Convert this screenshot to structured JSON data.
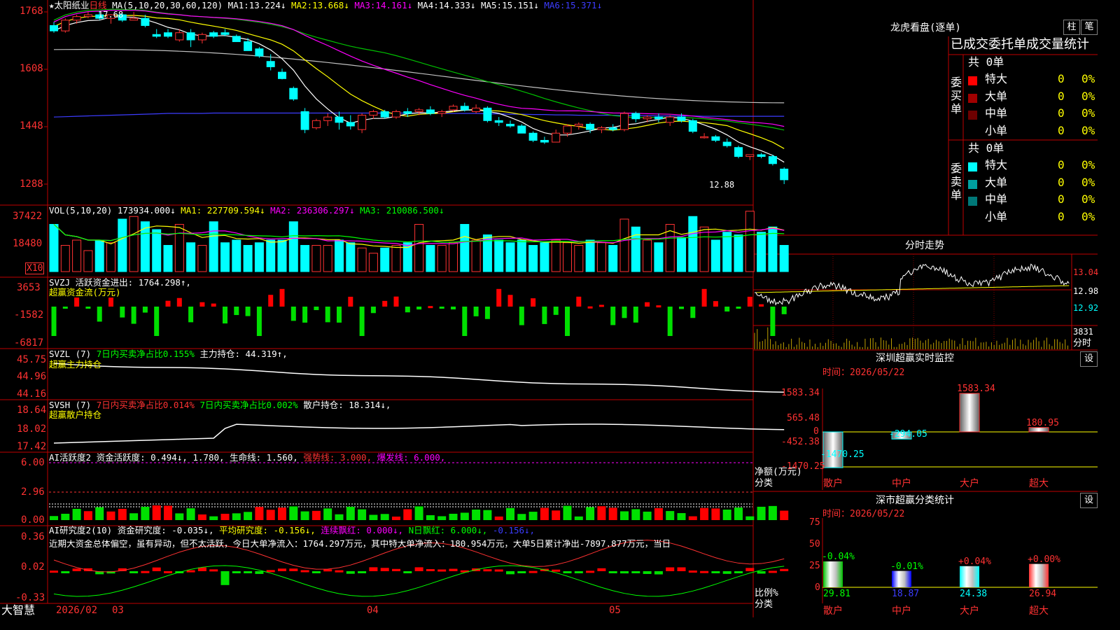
{
  "stock": {
    "star": "★",
    "name": "太阳纸业",
    "period": "日线",
    "ma_label": "MA(5,10,20,30,60,120)"
  },
  "price_panel": {
    "ma_values": [
      {
        "name": "MA1:",
        "value": "13.224↓",
        "color": "#ffffff"
      },
      {
        "name": "MA2:",
        "value": "13.668↓",
        "color": "#ffff00"
      },
      {
        "name": "MA3:",
        "value": "14.161↓",
        "color": "#ff00ff"
      },
      {
        "name": "MA4:",
        "value": "14.333↓",
        "color": "#00ff00"
      },
      {
        "name": "MA5:",
        "value": "15.151↓",
        "color": "#c0c0c0"
      },
      {
        "name": "MA6:",
        "value": "15.371↓",
        "color": "#3c3cff"
      }
    ],
    "y_ticks": [
      "1768",
      "1608",
      "1448",
      "1288"
    ],
    "high_label": "17.68",
    "low_label": "12.88",
    "colors": {
      "up": "#ff3232",
      "down": "#00ffff",
      "ma1": "#ffffff",
      "ma2": "#ffff00",
      "ma3": "#ff00ff",
      "ma4": "#00ff00",
      "ma5": "#c0c0c0",
      "ma6": "#3c3cff"
    }
  },
  "vol_panel": {
    "label": "VOL(5,10,20)",
    "value": "173934.000↓",
    "ma1": "MA1: 227709.594↓",
    "ma2": "MA2: 236306.297↓",
    "ma3": "MA3: 210086.500↓",
    "y_ticks": [
      "37422",
      "18480"
    ],
    "unit": "X10"
  },
  "svzj_panel": {
    "label": "SVZJ",
    "title": "活跃资金进出: 1764.298↑,",
    "subtitle": "超赢资金流(万元)",
    "y_ticks": [
      "3653",
      "-1582",
      "-6817"
    ]
  },
  "svzl_panel": {
    "label": "SVZL (7)",
    "t1": "7日内买卖净占比0.155%",
    "t2": "主力持仓: 44.319↑,",
    "subtitle": "超赢主力持仓",
    "y_ticks": [
      "45.75",
      "44.96",
      "44.16"
    ]
  },
  "svsh_panel": {
    "label": "SVSH (7)",
    "t1": "7日内买卖净占比0.014%",
    "t2": "7日内买卖净占比0.002%",
    "t3": "散户持仓: 18.314↓,",
    "subtitle": "超赢散户持仓",
    "y_ticks": [
      "18.64",
      "18.02",
      "17.42"
    ]
  },
  "ai1_panel": {
    "label": "AI活跃度2",
    "t1": "资金活跃度: 0.494↓,",
    "t2": "1.780,",
    "t3": "生命线: 1.560,",
    "t4": "强势线: 3.000,",
    "t5": "爆发线: 6.000,",
    "y_ticks": [
      "6.00",
      "2.96",
      "0.00"
    ]
  },
  "ai2_panel": {
    "label": "AI研究度2(10)",
    "t1": "资金研究度: -0.035↓,",
    "t2": "平均研究度: -0.156↓,",
    "t3": "连续飘红: 0.000↓,",
    "t4": "N日飘红: 6.000↓,",
    "t5": "-0.156↓,",
    "comment": "近期大资金总体偏空，虽有异动，但不太活跃，今日大单净流入：1764.297万元，其中特大单净流入：180.954万元，大单5日累计净出-7897.877万元，当日",
    "y_ticks": [
      "0.36",
      "0.02",
      "-0.33"
    ]
  },
  "xaxis": {
    "brand": "大智慧",
    "labels": [
      "2026/02",
      "03",
      "04",
      "05"
    ]
  },
  "dragon": {
    "title": "龙虎看盘(逐单)",
    "btn1": "柱",
    "btn2": "笔",
    "header": "已成交委托单成交量统计",
    "buy": {
      "side": "委买单",
      "total": "共 0单",
      "rows": [
        {
          "name": "特大",
          "v": "0",
          "p": "0%",
          "c": "#ff0000"
        },
        {
          "name": "大单",
          "v": "0",
          "p": "0%",
          "c": "#a00000"
        },
        {
          "name": "中单",
          "v": "0",
          "p": "0%",
          "c": "#6e0000"
        },
        {
          "name": "小单",
          "v": "0",
          "p": "0%",
          "c": "#000000"
        }
      ]
    },
    "sell": {
      "side": "委卖单",
      "total": "共 0单",
      "rows": [
        {
          "name": "特大",
          "v": "0",
          "p": "0%",
          "c": "#00ffff"
        },
        {
          "name": "大单",
          "v": "0",
          "p": "0%",
          "c": "#00a0a0"
        },
        {
          "name": "中单",
          "v": "0",
          "p": "0%",
          "c": "#007878"
        },
        {
          "name": "小单",
          "v": "0",
          "p": "0%",
          "c": "#000000"
        }
      ]
    }
  },
  "intraday": {
    "title": "分时走势",
    "price_labels": [
      "13.04",
      "12.98",
      "12.92"
    ],
    "vol_label": "3831",
    "footer": "分时"
  },
  "monitor": {
    "title": "深圳超赢实时监控",
    "btn": "设",
    "date": "时间：2026/05/22",
    "y_ticks": [
      "1583.34",
      "565.48",
      "0",
      "-452.38",
      "-1470.25"
    ],
    "ylabel1": "净额(万元)",
    "ylabel2": "分类",
    "bars": [
      {
        "cat": "散户",
        "value": -1470.25,
        "label": "-1470.25"
      },
      {
        "cat": "中户",
        "value": -294.05,
        "label": "-294.05"
      },
      {
        "cat": "大户",
        "value": 1583.34,
        "label": "1583.34"
      },
      {
        "cat": "超大",
        "value": 180.95,
        "label": "180.95"
      }
    ]
  },
  "classify": {
    "title": "深市超赢分类统计",
    "btn": "设",
    "date": "时间：2026/05/22",
    "y_ticks": [
      "75",
      "50",
      "25",
      "0"
    ],
    "ylabel1": "比例%",
    "ylabel2": "分类",
    "bars": [
      {
        "cat": "散户",
        "value": 29.81,
        "label": "29.81",
        "chg": "-0.04%",
        "col": "#00c000"
      },
      {
        "cat": "中户",
        "value": 18.87,
        "label": "18.87",
        "chg": "-0.01%",
        "col": "#0000ff"
      },
      {
        "cat": "大户",
        "value": 24.38,
        "label": "24.38",
        "chg": "+0.04%",
        "col": "#00ffff"
      },
      {
        "cat": "超大",
        "value": 26.94,
        "label": "26.94",
        "chg": "+0.00%",
        "col": "#ff3232"
      }
    ]
  },
  "chart_data": [
    {
      "type": "candlestick",
      "title": "太阳纸业 日线",
      "ylim": [
        12.7,
        17.8
      ],
      "x": [
        "2026/02",
        "03",
        "04",
        "05"
      ],
      "ohlc": [
        [
          17.3,
          17.4,
          17.1,
          17.15
        ],
        [
          17.15,
          17.5,
          17.1,
          17.45
        ],
        [
          17.45,
          17.6,
          17.35,
          17.55
        ],
        [
          17.55,
          17.68,
          17.5,
          17.6
        ],
        [
          17.6,
          17.7,
          17.45,
          17.5
        ],
        [
          17.5,
          17.62,
          17.35,
          17.6
        ],
        [
          17.6,
          17.65,
          17.4,
          17.45
        ],
        [
          17.45,
          17.68,
          17.45,
          17.5
        ],
        [
          17.5,
          17.6,
          17.25,
          17.3
        ],
        [
          17.05,
          17.2,
          16.95,
          17.0
        ],
        [
          17.1,
          17.2,
          16.95,
          17.0
        ],
        [
          16.9,
          17.2,
          16.85,
          17.1
        ],
        [
          17.1,
          17.2,
          16.7,
          16.9
        ],
        [
          16.9,
          17.1,
          16.8,
          17.05
        ],
        [
          17.1,
          17.15,
          16.95,
          17.0
        ],
        [
          17.1,
          17.2,
          17.0,
          17.05
        ],
        [
          17.0,
          17.05,
          16.85,
          16.85
        ],
        [
          16.85,
          16.95,
          16.6,
          16.6
        ],
        [
          16.65,
          16.7,
          16.4,
          16.45
        ],
        [
          16.3,
          16.5,
          16.05,
          16.15
        ],
        [
          16.0,
          16.1,
          15.8,
          15.82
        ],
        [
          15.55,
          15.6,
          15.2,
          15.25
        ],
        [
          14.9,
          15.0,
          14.3,
          14.4
        ],
        [
          14.45,
          14.7,
          14.4,
          14.65
        ],
        [
          14.65,
          14.85,
          14.5,
          14.75
        ],
        [
          14.75,
          14.9,
          14.4,
          14.6
        ],
        [
          14.6,
          14.8,
          14.4,
          14.5
        ],
        [
          14.4,
          14.85,
          14.3,
          14.8
        ],
        [
          14.8,
          14.95,
          14.7,
          14.9
        ],
        [
          14.9,
          14.95,
          14.7,
          14.75
        ],
        [
          14.75,
          14.95,
          14.7,
          14.9
        ],
        [
          14.9,
          15.0,
          14.75,
          14.85
        ],
        [
          14.9,
          15.0,
          14.8,
          14.95
        ],
        [
          14.95,
          15.05,
          14.8,
          14.85
        ],
        [
          14.85,
          14.95,
          14.75,
          14.9
        ],
        [
          14.95,
          15.1,
          14.9,
          15.05
        ],
        [
          15.05,
          15.15,
          14.9,
          14.95
        ],
        [
          14.9,
          15.1,
          14.85,
          15.0
        ],
        [
          15.0,
          15.05,
          14.6,
          14.65
        ],
        [
          14.65,
          14.75,
          14.5,
          14.6
        ],
        [
          14.55,
          14.65,
          14.45,
          14.5
        ],
        [
          14.5,
          14.55,
          14.3,
          14.3
        ],
        [
          14.3,
          14.35,
          14.05,
          14.1
        ],
        [
          14.1,
          14.2,
          14.0,
          14.05
        ],
        [
          14.05,
          14.4,
          14.05,
          14.3
        ],
        [
          14.3,
          14.55,
          14.2,
          14.5
        ],
        [
          14.5,
          14.6,
          14.4,
          14.55
        ],
        [
          14.55,
          14.6,
          14.3,
          14.4
        ],
        [
          14.4,
          14.5,
          14.3,
          14.45
        ],
        [
          14.45,
          14.55,
          14.35,
          14.4
        ],
        [
          14.4,
          14.9,
          14.35,
          14.85
        ],
        [
          14.85,
          14.9,
          14.6,
          14.7
        ],
        [
          14.7,
          14.8,
          14.6,
          14.75
        ],
        [
          14.75,
          14.85,
          14.6,
          14.7
        ],
        [
          14.6,
          14.8,
          14.5,
          14.75
        ],
        [
          14.75,
          14.85,
          14.6,
          14.65
        ],
        [
          14.65,
          14.7,
          14.3,
          14.35
        ],
        [
          14.2,
          14.3,
          14.15,
          14.2
        ],
        [
          14.2,
          14.25,
          14.05,
          14.1
        ],
        [
          14.05,
          14.15,
          13.9,
          13.95
        ],
        [
          13.9,
          13.95,
          13.6,
          13.65
        ],
        [
          13.65,
          13.7,
          13.55,
          13.7
        ],
        [
          13.7,
          13.75,
          13.6,
          13.65
        ],
        [
          13.65,
          13.7,
          13.4,
          13.45
        ],
        [
          13.3,
          13.35,
          12.88,
          13.0
        ]
      ],
      "series": [
        {
          "name": "MA1",
          "values": [
            17.35,
            17.4,
            17.45,
            17.5,
            17.48,
            17.5,
            17.48,
            17.45,
            17.4,
            17.3,
            17.2,
            17.1,
            17.05,
            17.0,
            17.0,
            17.0,
            16.95,
            16.85,
            16.7,
            16.5,
            16.2,
            15.9,
            15.5,
            15.2,
            14.95,
            14.75,
            14.65,
            14.6,
            14.65,
            14.7,
            14.75,
            14.8,
            14.85,
            14.85,
            14.85,
            14.9,
            14.95,
            14.95,
            14.9,
            14.85,
            14.75,
            14.65,
            14.5,
            14.35,
            14.3,
            14.3,
            14.35,
            14.4,
            14.45,
            14.5,
            14.55,
            14.6,
            14.65,
            14.7,
            14.72,
            14.7,
            14.6,
            14.5,
            14.4,
            14.25,
            14.1,
            13.95,
            13.8,
            13.6,
            13.4
          ]
        },
        {
          "name": "MA6",
          "values": [
            15.35,
            15.36,
            15.37,
            15.38,
            15.39,
            15.4,
            15.41,
            15.42,
            15.43,
            15.44,
            15.45,
            15.45,
            15.45,
            15.45,
            15.46,
            15.46,
            15.46,
            15.46,
            15.46,
            15.46,
            15.46,
            15.46,
            15.46,
            15.46,
            15.46,
            15.46,
            15.46,
            15.46,
            15.46,
            15.46,
            15.46,
            15.46,
            15.46,
            15.46,
            15.45,
            15.45,
            15.45,
            15.45,
            15.44,
            15.44,
            15.43,
            15.43,
            15.42,
            15.42,
            15.41,
            15.41,
            15.4,
            15.4,
            15.4,
            15.4,
            15.39,
            15.39,
            15.39,
            15.38,
            15.38,
            15.38,
            15.38,
            15.37,
            15.37,
            15.37,
            15.37,
            15.37,
            15.37,
            15.37,
            15.37
          ]
        }
      ]
    },
    {
      "type": "bar",
      "title": "深圳超赢实时监控",
      "categories": [
        "散户",
        "中户",
        "大户",
        "超大"
      ],
      "values": [
        -1470.25,
        -294.05,
        1583.34,
        180.95
      ],
      "ylabel": "净额(万元)"
    },
    {
      "type": "bar",
      "title": "深市超赢分类统计",
      "categories": [
        "散户",
        "中户",
        "大户",
        "超大"
      ],
      "values": [
        29.81,
        18.87,
        24.38,
        26.94
      ],
      "ylabel": "比例%"
    }
  ]
}
